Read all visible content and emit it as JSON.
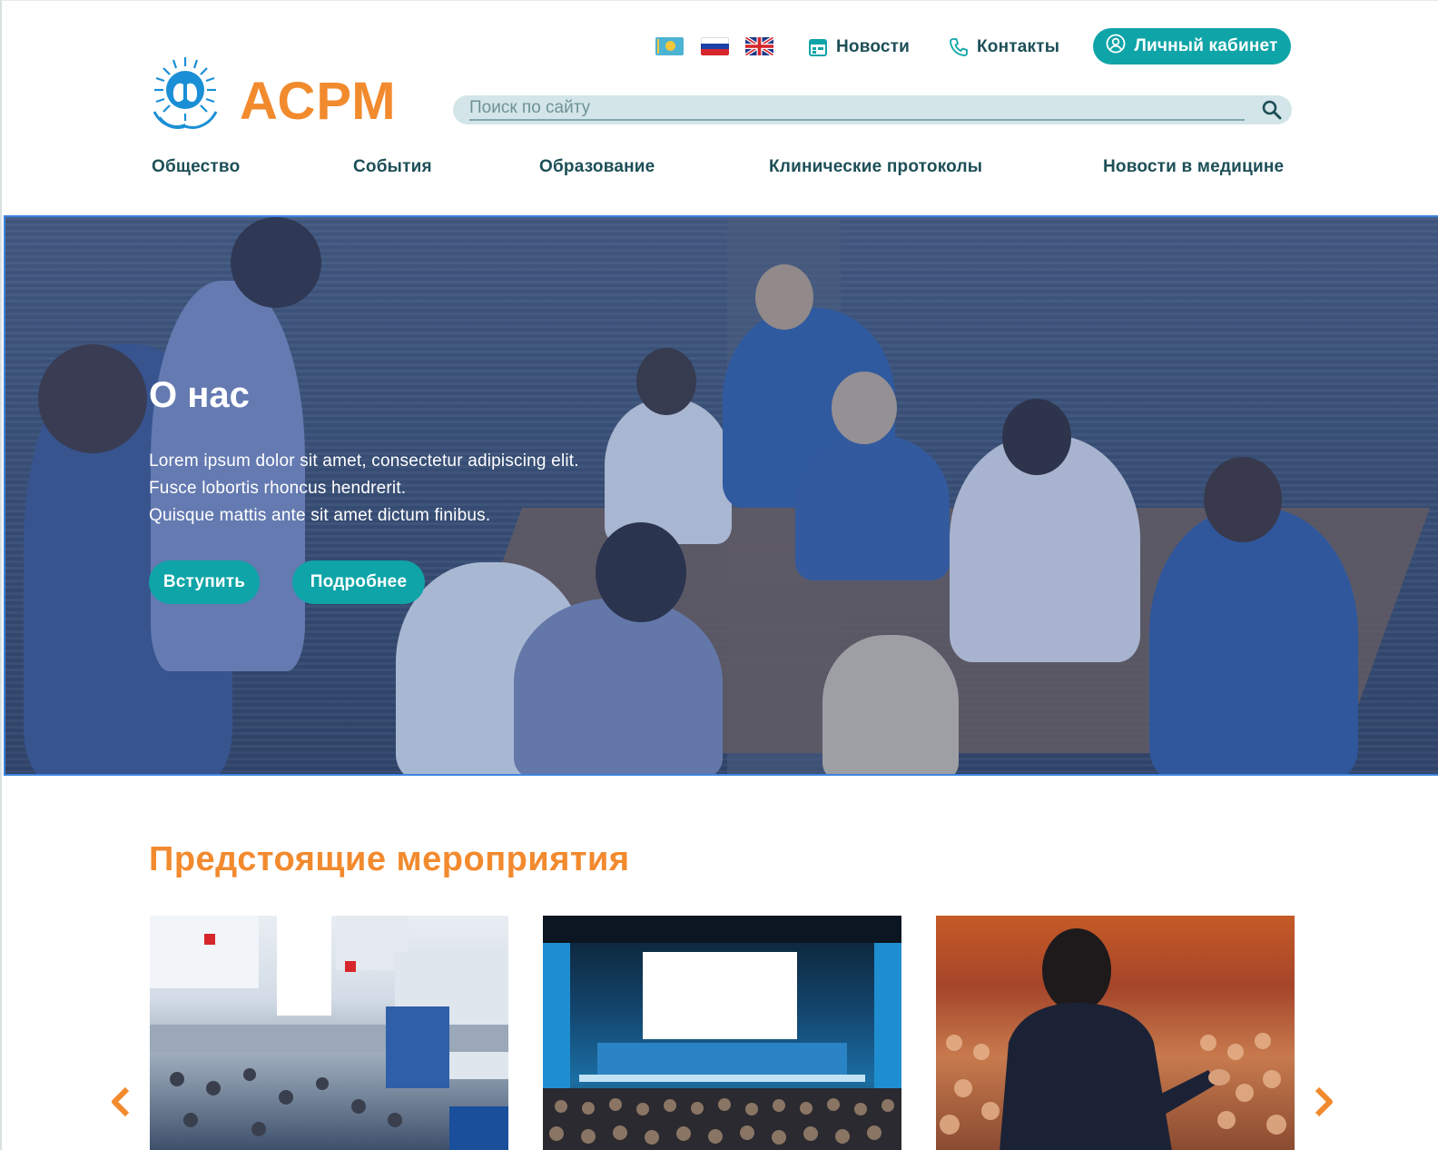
{
  "colors": {
    "accent_teal": "#0fa4a7",
    "brand_orange": "#f28a2e",
    "text_dark_teal": "#1d4f57",
    "search_bg": "#d3e5e8"
  },
  "header": {
    "languages": [
      {
        "flag": "kazakhstan-flag-icon"
      },
      {
        "flag": "russia-flag-icon"
      },
      {
        "flag": "uk-flag-icon"
      }
    ],
    "news_link": {
      "label": "Новости",
      "icon": "calendar-icon"
    },
    "contacts_link": {
      "label": "Контакты",
      "icon": "phone-icon"
    },
    "cabinet_button": {
      "label": "Личный кабинет",
      "icon": "user-circle-icon"
    },
    "logo": {
      "icon": "lungs-emblem-icon",
      "brand": "АСРМ"
    },
    "search": {
      "placeholder": "Поиск по сайту",
      "value": "",
      "icon": "search-icon"
    }
  },
  "main_nav": {
    "items": [
      {
        "label": "Общество"
      },
      {
        "label": "События"
      },
      {
        "label": "Образование"
      },
      {
        "label": "Клинические протоколы"
      },
      {
        "label": "Новости в медицине"
      }
    ]
  },
  "hero": {
    "title": "О нас",
    "text_lines": [
      "Lorem ipsum dolor sit amet, consectetur adipiscing elit.",
      "Fusce lobortis rhoncus hendrerit.",
      "Quisque mattis ante sit amet dictum finibus."
    ],
    "join_button": "Вступить",
    "more_button": "Подробнее"
  },
  "events": {
    "title": "Предстоящие мероприятия",
    "cards": [
      {
        "image": "exhibition-hall-photo"
      },
      {
        "image": "auditorium-screen-photo"
      },
      {
        "image": "speaker-audience-photo"
      }
    ],
    "prev_icon": "chevron-left-icon",
    "next_icon": "chevron-right-icon"
  }
}
